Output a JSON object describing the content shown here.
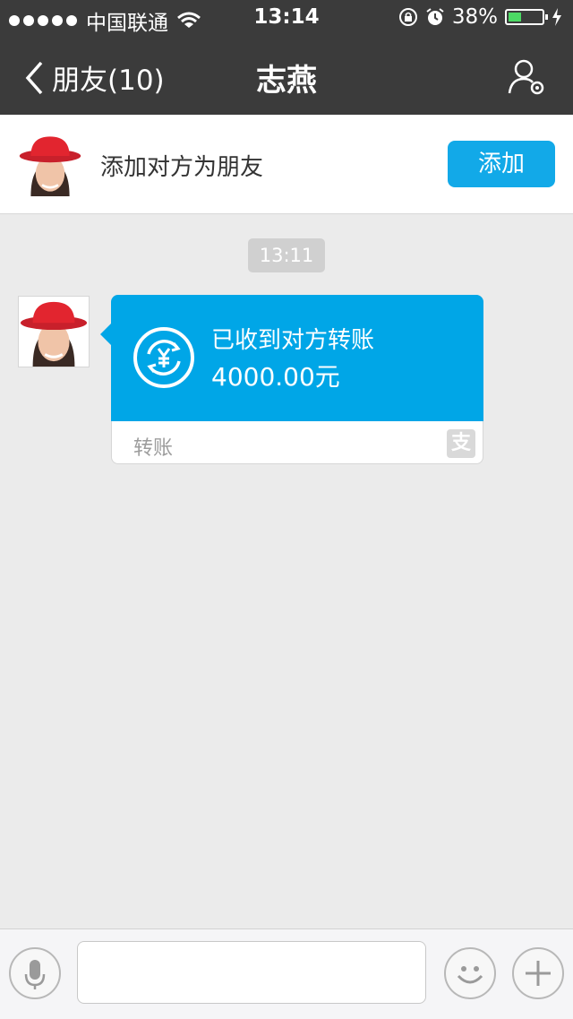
{
  "status_bar": {
    "carrier": "中国联通",
    "time": "13:14",
    "battery_percent": "38%",
    "battery_level": 0.38,
    "icons": [
      "signal-dots-icon",
      "wifi-icon",
      "orientation-lock-icon",
      "alarm-icon",
      "battery-icon",
      "charging-icon"
    ]
  },
  "nav": {
    "back_label": "朋友(10)",
    "title": "志燕",
    "right_icon": "profile-settings-icon"
  },
  "add_friend": {
    "text": "添加对方为朋友",
    "button_label": "添加"
  },
  "chat": {
    "timestamp": "13:11",
    "message": {
      "status": "已收到对方转账",
      "amount": "4000.00元",
      "footer_label": "转账",
      "icon": "yuan-transfer-icon",
      "brand_icon": "alipay-icon",
      "brand_glyph": "支"
    }
  },
  "input_bar": {
    "value": "",
    "icons": [
      "microphone-icon",
      "emoji-icon",
      "plus-icon"
    ]
  },
  "colors": {
    "nav_bg": "#3b3b3b",
    "accent": "#12a9e8",
    "bubble_blue": "#00a6e7",
    "chat_bg": "#ebebeb"
  }
}
